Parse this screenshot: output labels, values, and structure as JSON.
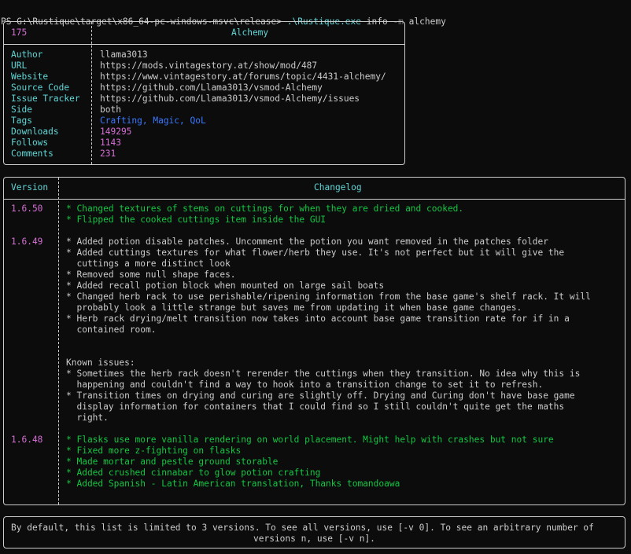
{
  "prompt": {
    "prefix": "PS G:\\Rustique\\target\\x86_64-pc-windows-msvc\\release> ",
    "exe": ".\\Rustique.exe",
    "args_1": " info ",
    "flag": "-m",
    "args_2": " alchemy"
  },
  "info_table": {
    "id": "175",
    "name": "Alchemy",
    "rows": [
      {
        "label": "Author",
        "value": "llama3013",
        "color": "#cccccc"
      },
      {
        "label": "URL",
        "value": "https://mods.vintagestory.at/show/mod/487",
        "color": "#cccccc"
      },
      {
        "label": "Website",
        "value": "https://www.vintagestory.at/forums/topic/4431-alchemy/",
        "color": "#cccccc"
      },
      {
        "label": "Source Code",
        "value": "https://github.com/Llama3013/vsmod-Alchemy",
        "color": "#cccccc"
      },
      {
        "label": "Issue Tracker",
        "value": "https://github.com/Llama3013/vsmod-Alchemy/issues",
        "color": "#cccccc"
      },
      {
        "label": "Side",
        "value": "both",
        "color": "#cccccc"
      },
      {
        "label": "Tags",
        "value": "Crafting, Magic, QoL",
        "color": "#3b78ff"
      },
      {
        "label": "Downloads",
        "value": "149295",
        "color": "#d670d6"
      },
      {
        "label": "Follows",
        "value": "1143",
        "color": "#d670d6"
      },
      {
        "label": "Comments",
        "value": "231",
        "color": "#d670d6"
      }
    ]
  },
  "changelog_table": {
    "header_version": "Version",
    "header_changelog": "Changelog",
    "entries": [
      {
        "version": "1.6.50",
        "lines": [
          {
            "text": "* Changed textures of stems on cuttings for when they are dried and cooked.",
            "color": "#13c642"
          },
          {
            "text": "* Flipped the cooked cuttings item inside the GUI",
            "color": "#13c642"
          }
        ]
      },
      {
        "version": "1.6.49",
        "lines": [
          {
            "text": "* Added potion disable patches. Uncomment the potion you want removed in the patches folder",
            "color": "#cccccc"
          },
          {
            "text": "* Added cuttings textures for what flower/herb they use. It's not perfect but it will give the",
            "color": "#cccccc"
          },
          {
            "text": "  cuttings a more distinct look",
            "color": "#cccccc"
          },
          {
            "text": "* Removed some null shape faces.",
            "color": "#cccccc"
          },
          {
            "text": "* Added recall potion block when mounted on large sail boats",
            "color": "#cccccc"
          },
          {
            "text": "* Changed herb rack to use perishable/ripening information from the base game's shelf rack. It will",
            "color": "#cccccc"
          },
          {
            "text": "  probably look a little strange but saves me from updating it when base game changes.",
            "color": "#cccccc"
          },
          {
            "text": "* Herb rack drying/melt transition now takes into account base game transition rate for if in a",
            "color": "#cccccc"
          },
          {
            "text": "  contained room.",
            "color": "#cccccc"
          },
          {
            "text": "",
            "color": "#cccccc"
          },
          {
            "text": "",
            "color": "#cccccc"
          },
          {
            "text": "Known issues:",
            "color": "#cccccc"
          },
          {
            "text": "* Sometimes the herb rack doesn't rerender the cuttings when they transition. No idea why this is",
            "color": "#cccccc"
          },
          {
            "text": "  happening and couldn't find a way to hook into a transition change to set it to refresh.",
            "color": "#cccccc"
          },
          {
            "text": "* Transition times on drying and curing are slightly off. Drying and Curing don't have base game",
            "color": "#cccccc"
          },
          {
            "text": "  display information for containers that I could find so I still couldn't quite get the maths",
            "color": "#cccccc"
          },
          {
            "text": "  right.",
            "color": "#cccccc"
          }
        ]
      },
      {
        "version": "1.6.48",
        "lines": [
          {
            "text": "* Flasks use more vanilla rendering on world placement. Might help with crashes but not sure",
            "color": "#13c642"
          },
          {
            "text": "* Fixed more z-fighting on flasks",
            "color": "#13c642"
          },
          {
            "text": "* Made mortar and pestle ground storable",
            "color": "#13c642"
          },
          {
            "text": "* Added crushed cinnabar to glow potion crafting",
            "color": "#13c642"
          },
          {
            "text": "* Added Spanish - Latin American translation, Thanks tomandoawa",
            "color": "#13c642"
          }
        ]
      }
    ]
  },
  "footer": {
    "line1": "By default, this list is limited to 3 versions. To see all versions, use [-v 0]. To see an arbitrary number of",
    "line2": "versions n, use [-v n]."
  },
  "colors": {
    "background": "#0c0c0c",
    "text": "#cccccc",
    "cyan": "#61d6d6",
    "magenta": "#d670d6",
    "green": "#13c642",
    "blue": "#3b78ff"
  }
}
